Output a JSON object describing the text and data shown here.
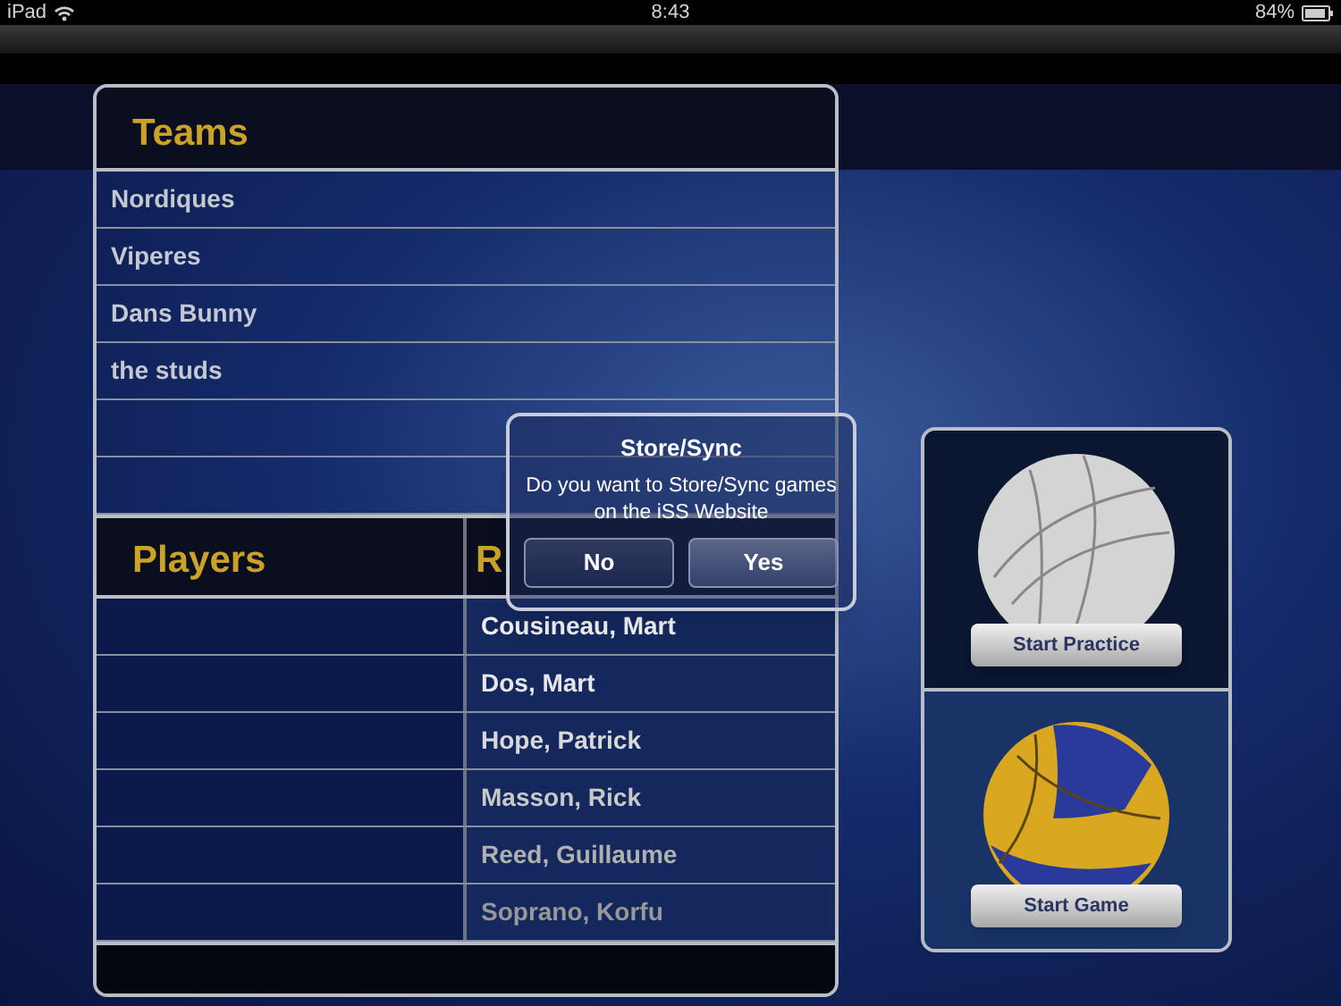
{
  "status_bar": {
    "device": "iPad",
    "time": "8:43",
    "battery": "84%"
  },
  "teams": {
    "title": "Teams",
    "rows": [
      "Nordiques",
      "Viperes",
      "Dans Bunny",
      "the studs"
    ]
  },
  "players": {
    "title": "Players",
    "roster_title": "R",
    "roster": [
      "Cousineau, Mart",
      "Dos, Mart",
      "Hope, Patrick",
      "Masson, Rick",
      "Reed, Guillaume",
      "Soprano, Korfu"
    ]
  },
  "actions": [
    {
      "kind": "practice",
      "label": "Start Practice"
    },
    {
      "kind": "game",
      "label": "Start Game"
    }
  ],
  "alert": {
    "title": "Store/Sync",
    "message": "Do you want to Store/Sync games on the iSS Website",
    "buttons": [
      "No",
      "Yes"
    ]
  }
}
